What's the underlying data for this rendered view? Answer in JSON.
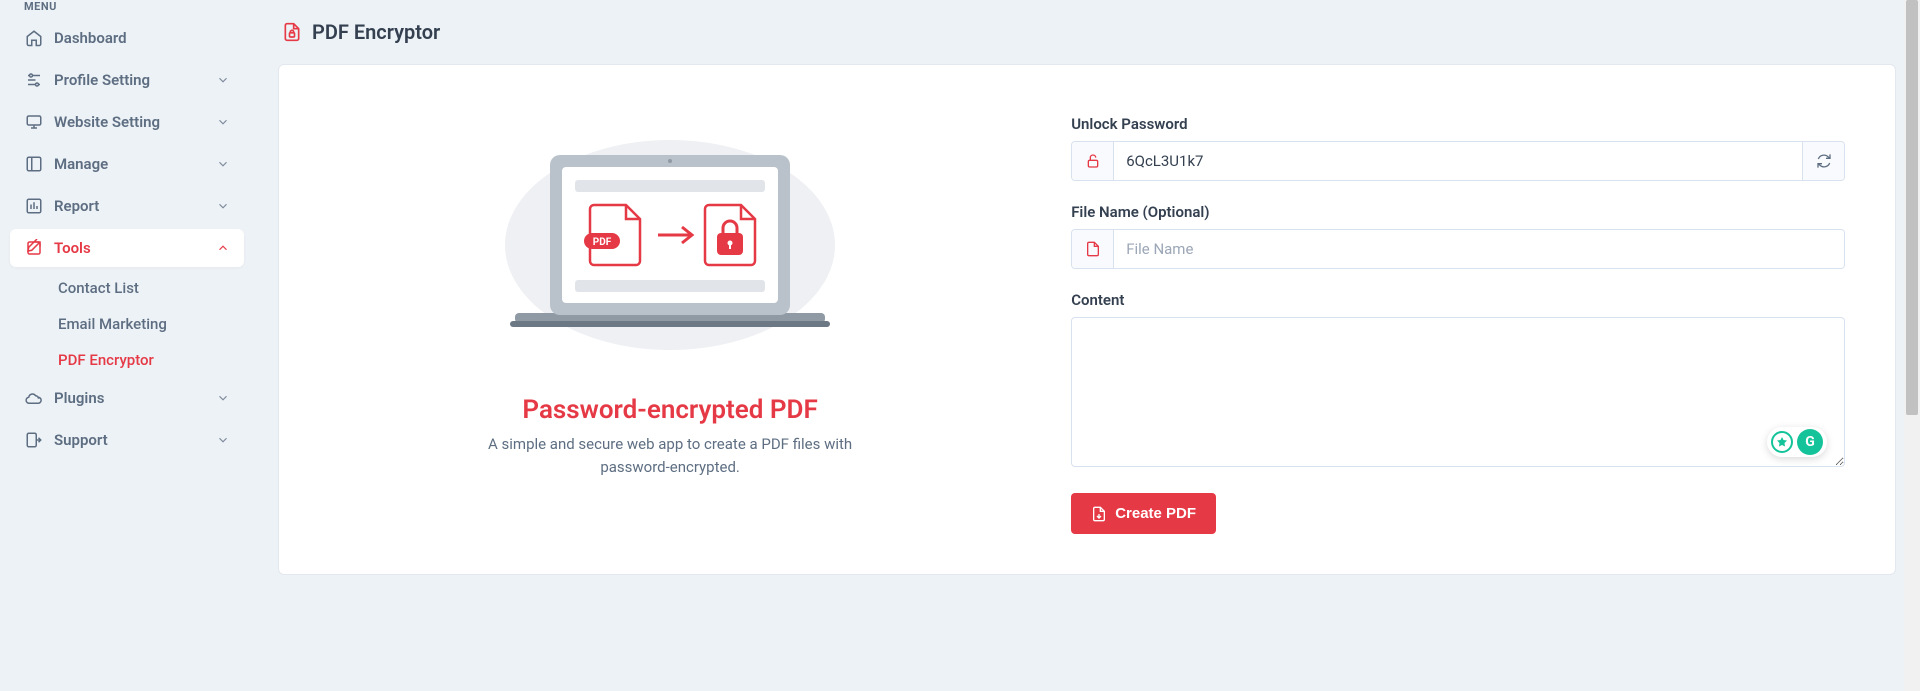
{
  "sidebar": {
    "heading": "MENU",
    "items": [
      {
        "label": "Dashboard",
        "icon": "home-icon",
        "hasChildren": false
      },
      {
        "label": "Profile Setting",
        "icon": "sliders-icon",
        "hasChildren": true
      },
      {
        "label": "Website Setting",
        "icon": "monitor-icon",
        "hasChildren": true
      },
      {
        "label": "Manage",
        "icon": "layout-icon",
        "hasChildren": true
      },
      {
        "label": "Report",
        "icon": "barchart-icon",
        "hasChildren": true
      },
      {
        "label": "Tools",
        "icon": "pencil-icon",
        "hasChildren": true,
        "active": true,
        "children": [
          {
            "label": "Contact List"
          },
          {
            "label": "Email Marketing"
          },
          {
            "label": "PDF Encryptor",
            "active": true
          }
        ]
      },
      {
        "label": "Plugins",
        "icon": "cloud-icon",
        "hasChildren": true
      },
      {
        "label": "Support",
        "icon": "exit-icon",
        "hasChildren": true
      }
    ]
  },
  "page": {
    "title": "PDF Encryptor",
    "illustration": {
      "heading": "Password-encrypted PDF",
      "subtext": "A simple and secure web app to create a PDF files with password-encrypted."
    },
    "form": {
      "password_label": "Unlock Password",
      "password_value": "6QcL3U1k7",
      "filename_label": "File Name (Optional)",
      "filename_placeholder": "File Name",
      "filename_value": "",
      "content_label": "Content",
      "content_value": "",
      "submit_label": "Create PDF"
    }
  },
  "colors": {
    "accent": "#e63946",
    "green": "#15c39a"
  }
}
